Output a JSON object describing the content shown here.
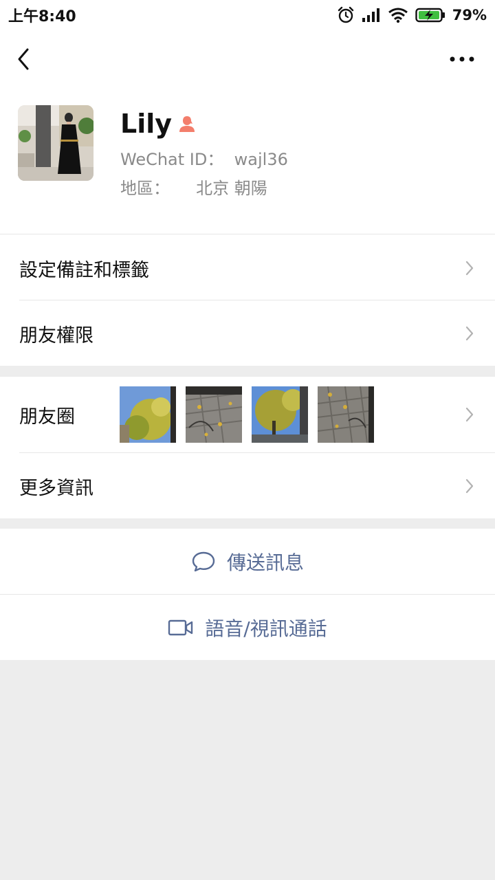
{
  "status": {
    "time": "上午8:40",
    "battery_percent": "79%",
    "icons": [
      "alarm-icon",
      "signal-icon",
      "wifi-icon",
      "battery-charging-icon"
    ]
  },
  "nav": {
    "back_icon": "chevron-left-icon",
    "more_icon": "more-dots-icon"
  },
  "profile": {
    "name": "Lily",
    "gender_icon": "female-icon",
    "wechat_id_label": "WeChat ID：",
    "wechat_id": "wajl36",
    "region_label": "地區：",
    "region": "北京 朝陽"
  },
  "menu": {
    "remarks_tags": "設定備註和標籤",
    "friend_permissions": "朋友權限",
    "moments": "朋友圈",
    "more_info": "更多資訊"
  },
  "actions": {
    "send_message": "傳送訊息",
    "voice_video_call": "語音/視訊通話"
  },
  "colors": {
    "link_blue": "#576b95",
    "background": "#ededed",
    "female_badge": "#f37e6c"
  }
}
